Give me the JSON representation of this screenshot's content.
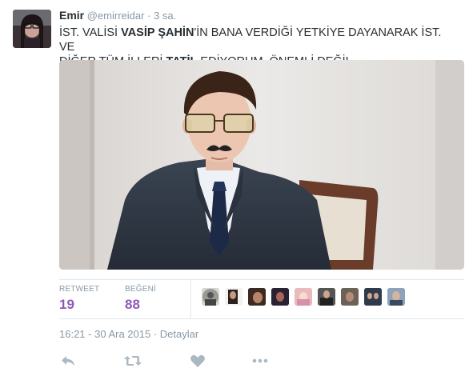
{
  "user": {
    "name": "Emir",
    "handle": "@emirreidar",
    "separator": "·",
    "time": "3 sa."
  },
  "tweet": {
    "line1_part1": "İST. VALİSİ ",
    "line1_bold1": "VASİP ŞAHİN",
    "line1_part2": "'İN BANA VERDİĞİ YETKİYE DAYANARAK İST. VE",
    "line2_part1": "DİĞER TÜM İLLERİ ",
    "line2_bold1": "TATİL",
    "line2_part2": " EDİYORUM. ÖNEMLİ DEĞİL"
  },
  "stats": {
    "retweet_label": "RETWEET",
    "retweet_count": "19",
    "like_label": "BEĞENİ",
    "like_count": "88"
  },
  "meta": {
    "timestamp": "16:21 - 30 Ara 2015",
    "separator": "·",
    "details": "Detaylar"
  },
  "colors": {
    "accent": "#8e5ab6",
    "muted": "#8899a6",
    "text": "#292f33"
  },
  "icons": {
    "reply": "reply-icon",
    "retweet": "retweet-icon",
    "like": "heart-icon",
    "more": "more-icon"
  }
}
